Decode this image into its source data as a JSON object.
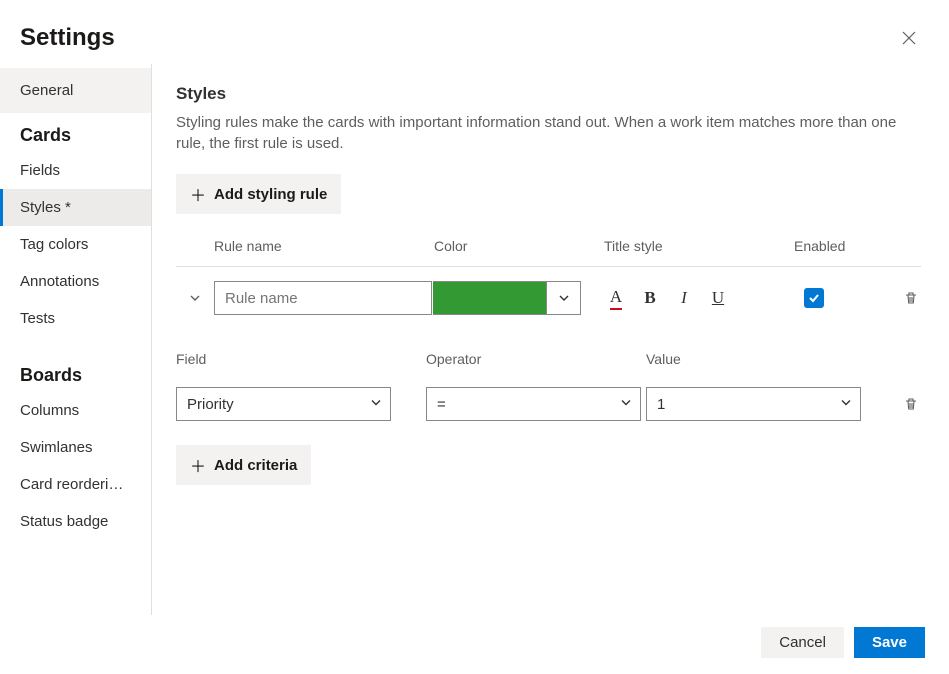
{
  "header": {
    "title": "Settings"
  },
  "sidebar": {
    "general_label": "General",
    "groups": [
      {
        "title": "Cards",
        "items": [
          {
            "label": "Fields"
          },
          {
            "label": "Styles *",
            "selected": true
          },
          {
            "label": "Tag colors"
          },
          {
            "label": "Annotations"
          },
          {
            "label": "Tests"
          }
        ]
      },
      {
        "title": "Boards",
        "items": [
          {
            "label": "Columns"
          },
          {
            "label": "Swimlanes"
          },
          {
            "label": "Card reorderi…"
          },
          {
            "label": "Status badge"
          }
        ]
      }
    ]
  },
  "main": {
    "title": "Styles",
    "description": "Styling rules make the cards with important information stand out. When a work item matches more than one rule, the first rule is used.",
    "add_rule_label": "Add styling rule",
    "columns": {
      "rulename": "Rule name",
      "color": "Color",
      "titlestyle": "Title style",
      "enabled": "Enabled"
    },
    "rule": {
      "name_placeholder": "Rule name",
      "name_value": "",
      "color": "#339933",
      "enabled": true
    },
    "title_style": {
      "font_color_letter": "A",
      "bold_letter": "B",
      "italic_letter": "I",
      "underline_letter": "U"
    },
    "criteria_columns": {
      "field": "Field",
      "operator": "Operator",
      "value": "Value"
    },
    "criteria": {
      "field": "Priority",
      "operator": "=",
      "value": "1"
    },
    "add_criteria_label": "Add criteria"
  },
  "footer": {
    "cancel": "Cancel",
    "save": "Save"
  }
}
